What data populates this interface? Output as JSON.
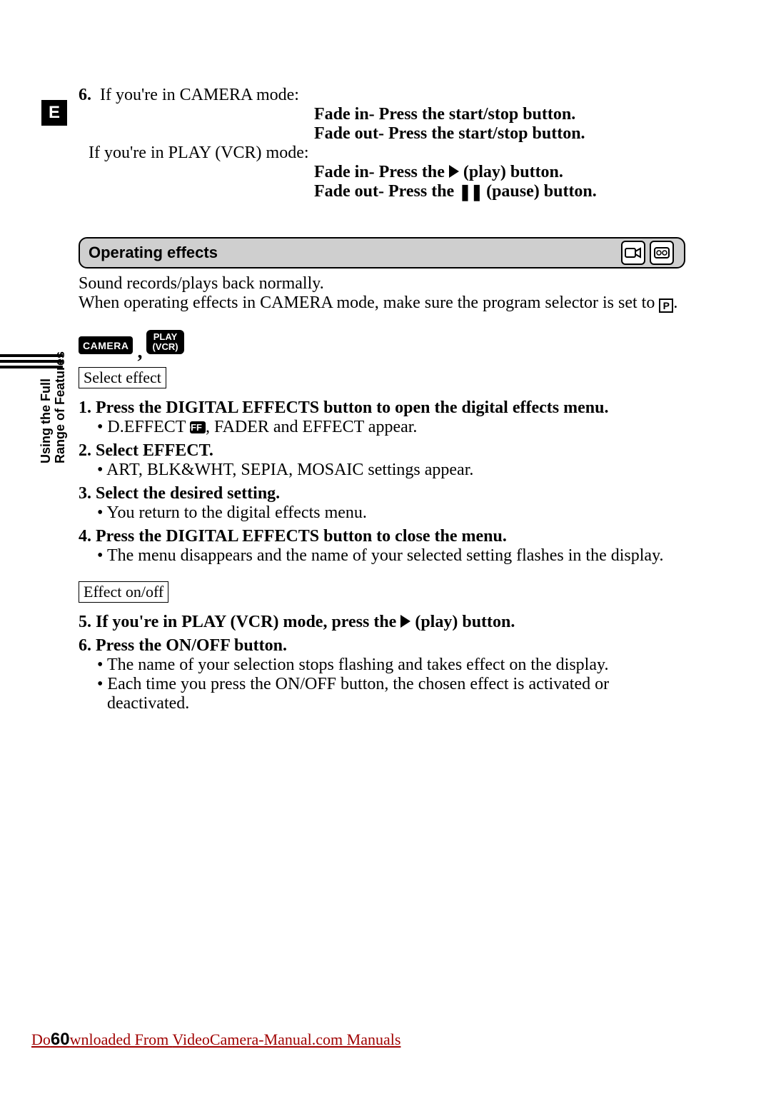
{
  "edge_letter": "E",
  "sidebar": {
    "line1": "Using the Full",
    "line2": "Range of Features"
  },
  "top": {
    "item6_num": "6.",
    "item6_text": "  If you're in CAMERA mode:",
    "camera_fadein": "Fade in- Press the start/stop button.",
    "camera_fadeout": "Fade out- Press the start/stop button.",
    "play_intro": "If you're in PLAY (VCR) mode:",
    "play_fadein_pre": "Fade in- Press the ",
    "play_fadein_post": " (play) button.",
    "play_fadeout_pre": "Fade out- Press the ",
    "play_fadeout_post": " (pause) button."
  },
  "section": {
    "title": "Operating effects"
  },
  "intro": {
    "line1": "Sound records/plays back normally.",
    "line2_pre": "When operating effects in CAMERA mode, make sure the program selector is set to ",
    "p_label": "P",
    "line2_post": "."
  },
  "modes": {
    "camera": "CAMERA",
    "play_line1": "PLAY",
    "play_line2": "(VCR)"
  },
  "box_select_effect": "Select effect",
  "steps": {
    "s1": {
      "num": "1.",
      "head": "Press the DIGITAL EFFECTS button to open the digital effects menu.",
      "b1_pre": "D.EFFECT ",
      "off": "OFF",
      "b1_post": ", FADER and EFFECT appear."
    },
    "s2": {
      "num": "2.",
      "head": "Select EFFECT.",
      "b1": "ART, BLK&WHT, SEPIA, MOSAIC settings appear."
    },
    "s3": {
      "num": "3.",
      "head": "Select the desired setting.",
      "b1": "You return to the digital effects menu."
    },
    "s4": {
      "num": "4.",
      "head": "Press the DIGITAL EFFECTS button to close the menu.",
      "b1": "The menu disappears and the name of your selected setting flashes in the display."
    },
    "s5": {
      "num": "5.",
      "head_pre": "If you're in PLAY (VCR) mode, press the ",
      "head_post": " (play) button."
    },
    "s6": {
      "num": "6.",
      "head": "Press the ON/OFF button.",
      "b1": "The name of your selection stops flashing and takes effect on the display.",
      "b2": "Each time you press the ON/OFF button, the chosen effect is activated or deactivated."
    }
  },
  "box_effect_onoff": "Effect on/off",
  "footer": {
    "pre": "Do",
    "page": "60",
    "mid": "wnloaded From ",
    "link": "VideoCamera-Manual.com Manuals"
  }
}
